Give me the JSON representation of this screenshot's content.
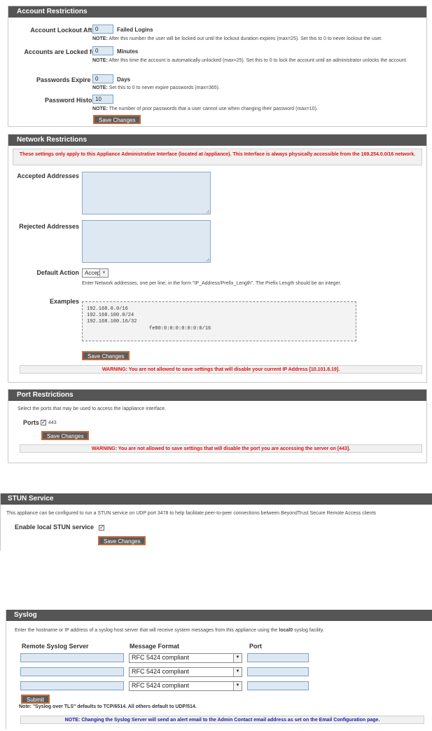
{
  "account": {
    "header": "Account Restrictions",
    "lockout_label": "Account Lockout After",
    "lockout_value": "0",
    "lockout_unit": "Failed Logins",
    "lockout_note_prefix": "NOTE:",
    "lockout_note": "After this number the user will be locked out until the lockout duration expires (max=25). Set this to 0 to never lockout the user.",
    "locked_label": "Accounts are Locked for",
    "locked_value": "0",
    "locked_unit": "Minutes",
    "locked_note_prefix": "NOTE:",
    "locked_note": "After this time the account is automatically unlocked (max=25). Set this to 0 to lock the account until an administrator unlocks the account.",
    "expire_label": "Passwords Expire in",
    "expire_value": "0",
    "expire_unit": "Days",
    "expire_note_prefix": "NOTE:",
    "expire_note": "Set this to 0 to never expire passwords (max=365).",
    "history_label": "Password History",
    "history_value": "10",
    "history_note_prefix": "NOTE:",
    "history_note": "The number of prior passwords that a user cannot use when changing their password (max=10).",
    "save_label": "Save Changes"
  },
  "network": {
    "header": "Network Restrictions",
    "info": "These settings only apply to this Appliance Administrative Interface (located at /appliance). This Interface is always physically accessible from the 169.254.0.0/16 network.",
    "accepted_label": "Accepted Addresses",
    "rejected_label": "Rejected Addresses",
    "default_action_label": "Default Action",
    "default_action_value": "Accept",
    "help": "Enter Network addresses, one per line, in the form \"IP_Address/Prefix_Length\". The Prefix Length should be an integer.",
    "examples_label": "Examples",
    "examples": [
      "192.168.0.0/16",
      "192.168.100.0/24",
      "192.168.100.16/32",
      "fe80:0:0:0:0:0:0:0/16"
    ],
    "save_label": "Save Changes",
    "warning": "WARNING: You are not allowed to save settings that will disable your current IP Address [10.101.8.19]."
  },
  "port": {
    "header": "Port Restrictions",
    "desc": "Select the ports that may be used to access the /appliance interface.",
    "ports_label": "Ports",
    "port_value": "443",
    "port_checked": true,
    "save_label": "Save Changes",
    "warning": "WARNING: You are not allowed to save settings that will disable the port you are accessing the server on [443]."
  },
  "stun": {
    "header": "STUN Service",
    "desc": "This appliance can be configured to run a STUN service on UDP port 3478 to help facilitate peer-to-peer connections between BeyondTrust Secure Remote Access clients",
    "enable_label": "Enable local STUN service",
    "enabled": true,
    "save_label": "Save Changes"
  },
  "syslog": {
    "header": "Syslog",
    "desc_before": "Enter the hostname or IP address of a syslog host server that will receive system messages from this appliance using the",
    "desc_bold": "local0",
    "desc_after": "syslog facility.",
    "col_server": "Remote Syslog Server",
    "col_format": "Message Format",
    "col_port": "Port",
    "rows": [
      {
        "server": "",
        "format": "RFC 5424 compliant",
        "port": ""
      },
      {
        "server": "",
        "format": "RFC 5424 compliant",
        "port": ""
      },
      {
        "server": "",
        "format": "RFC 5424 compliant",
        "port": ""
      }
    ],
    "submit_label": "Submit",
    "note_tls": "Note: \"Syslog over TLS\" defaults to TCP/6514. All others default to UDP/514.",
    "note_alert": "NOTE: Changing the Syslog Server will send an alert email to the Admin Contact email address as set on the Email Configuration page."
  },
  "colors": {
    "header_bg": "#555555",
    "input_bg": "#dde8f2",
    "warning_text": "#e01010",
    "info_text": "#1a1aa8",
    "button_border": "#c56a3a"
  }
}
